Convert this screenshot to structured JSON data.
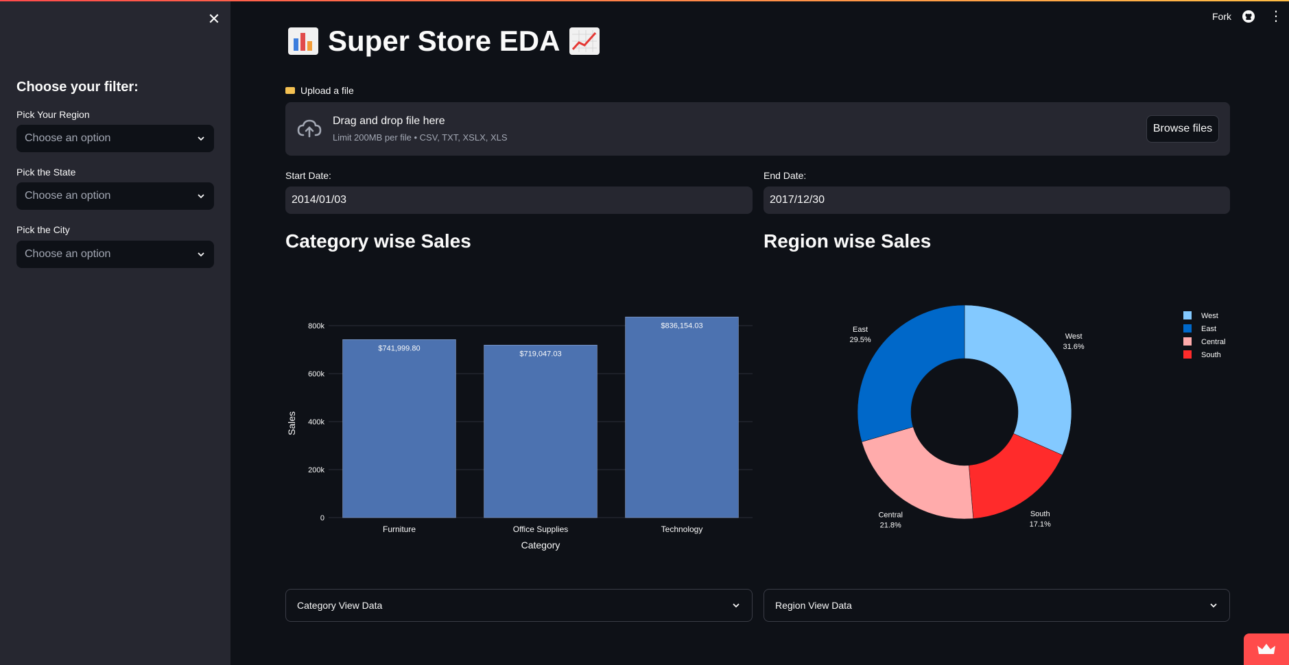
{
  "sidebar": {
    "heading": "Choose your filter:",
    "filters": [
      {
        "label": "Pick Your Region",
        "placeholder": "Choose an option"
      },
      {
        "label": "Pick the State",
        "placeholder": "Choose an option"
      },
      {
        "label": "Pick the City",
        "placeholder": "Choose an option"
      }
    ]
  },
  "header": {
    "fork_label": "Fork"
  },
  "main": {
    "title": "Super Store EDA",
    "upload": {
      "label": "Upload a file",
      "drop_title": "Drag and drop file here",
      "drop_sub": "Limit 200MB per file • CSV, TXT, XSLX, XLS",
      "browse_label": "Browse files"
    },
    "start_date": {
      "label": "Start Date:",
      "value": "2014/01/03"
    },
    "end_date": {
      "label": "End Date:",
      "value": "2017/12/30"
    },
    "category_title": "Category wise Sales",
    "region_title": "Region wise Sales",
    "category_expander": "Category View Data",
    "region_expander": "Region View Data"
  },
  "chart_data": [
    {
      "type": "bar",
      "categories": [
        "Furniture",
        "Office Supplies",
        "Technology"
      ],
      "values": [
        741999.8,
        719047.03,
        836154.03
      ],
      "data_labels": [
        "$741,999.80",
        "$719,047.03",
        "$836,154.03"
      ],
      "xlabel": "Category",
      "ylabel": "Sales",
      "yticks": [
        "0",
        "200k",
        "400k",
        "600k",
        "800k"
      ],
      "ylim": [
        0,
        880000
      ],
      "color": "#4c72b0"
    },
    {
      "type": "pie",
      "hole": 0.5,
      "slices": [
        {
          "name": "West",
          "value": 31.6,
          "label": "31.6%",
          "color": "#83c9ff"
        },
        {
          "name": "South",
          "value": 17.1,
          "label": "17.1%",
          "color": "#ff2b2b"
        },
        {
          "name": "Central",
          "value": 21.8,
          "label": "21.8%",
          "color": "#ffabab"
        },
        {
          "name": "East",
          "value": 29.5,
          "label": "29.5%",
          "color": "#0068c9"
        }
      ],
      "legend": [
        {
          "name": "West",
          "color": "#83c9ff"
        },
        {
          "name": "East",
          "color": "#0068c9"
        },
        {
          "name": "Central",
          "color": "#ffabab"
        },
        {
          "name": "South",
          "color": "#ff2b2b"
        }
      ],
      "legend_position": "top-right"
    }
  ]
}
